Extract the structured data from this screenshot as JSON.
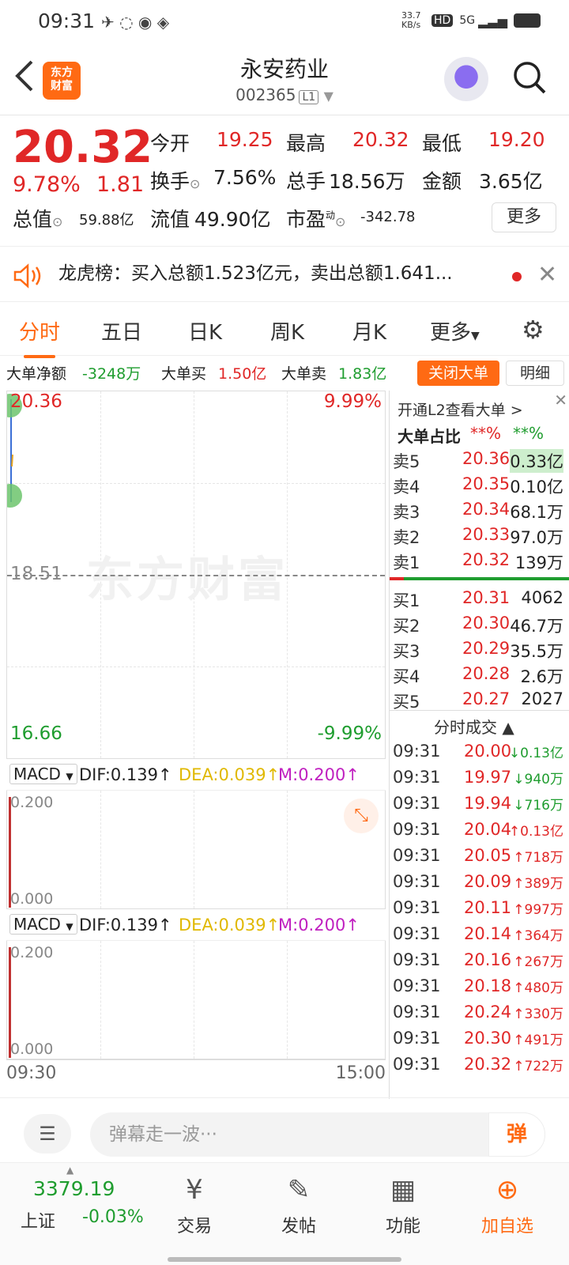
{
  "status": {
    "time": "09:31",
    "speed": "33.7 KB/s",
    "hd": "HD",
    "net": "5G"
  },
  "header": {
    "back": "<",
    "logo_line1": "东方",
    "logo_line2": "财富",
    "title": "永安药业",
    "code": "002365",
    "code_tag": "L1"
  },
  "quote": {
    "price": "20.32",
    "change_pct": "9.78%",
    "change": "1.81",
    "open_label": "今开",
    "open": "19.25",
    "high_label": "最高",
    "high": "20.32",
    "low_label": "最低",
    "low": "19.20",
    "turnover_label": "换手",
    "turnover": "7.56%",
    "volume_label": "总手",
    "volume": "18.56万",
    "amount_label": "金额",
    "amount": "3.65亿",
    "mktcap_label": "总值",
    "mktcap": "59.88亿",
    "float_label": "流值",
    "float": "49.90亿",
    "pe_label": "市盈",
    "pe_sup": "动",
    "pe": "-342.78",
    "more": "更多"
  },
  "notice": {
    "text": "龙虎榜：买入总额1.523亿元，卖出总额1.641..."
  },
  "tabs": [
    "分时",
    "五日",
    "日K",
    "周K",
    "月K",
    "更多"
  ],
  "bigorder": {
    "net_label": "大单净额",
    "net": "-3248万",
    "buy_label": "大单买",
    "buy": "1.50亿",
    "sell_label": "大单卖",
    "sell": "1.83亿",
    "close": "关闭大单",
    "detail": "明细"
  },
  "chart": {
    "top_price": "20.36",
    "top_pct": "9.99%",
    "mid_price": "18.51",
    "bottom_price": "16.66",
    "bottom_pct": "-9.99%",
    "watermark": "东方财富",
    "x_start": "09:30",
    "x_end": "15:00"
  },
  "macd1": {
    "name": "MACD",
    "dif": "DIF:0.139",
    "dea": "DEA:0.039",
    "m": "M:0.200",
    "y_top": "0.200",
    "y_bottom": "0.000"
  },
  "macd2": {
    "name": "MACD",
    "dif": "DIF:0.139",
    "dea": "DEA:0.039",
    "m": "M:0.200",
    "y_top": "0.200",
    "y_bottom": "0.000"
  },
  "book": {
    "l2": "开通L2查看大单 >",
    "ratio_label": "大单占比",
    "ratio_a": "**%",
    "ratio_b": "**%",
    "sells": [
      {
        "l": "卖5",
        "p": "20.36",
        "v": "0.33亿"
      },
      {
        "l": "卖4",
        "p": "20.35",
        "v": "0.10亿"
      },
      {
        "l": "卖3",
        "p": "20.34",
        "v": "68.1万"
      },
      {
        "l": "卖2",
        "p": "20.33",
        "v": "97.0万"
      },
      {
        "l": "卖1",
        "p": "20.32",
        "v": "139万"
      }
    ],
    "buys": [
      {
        "l": "买1",
        "p": "20.31",
        "v": "4062"
      },
      {
        "l": "买2",
        "p": "20.30",
        "v": "46.7万"
      },
      {
        "l": "买3",
        "p": "20.29",
        "v": "35.5万"
      },
      {
        "l": "买4",
        "p": "20.28",
        "v": "2.6万"
      },
      {
        "l": "买5",
        "p": "20.27",
        "v": "2027"
      }
    ],
    "trades_title": "分时成交 ▲",
    "trades": [
      {
        "t": "09:31",
        "p": "20.00",
        "v": "↓0.13亿",
        "dir": "down"
      },
      {
        "t": "09:31",
        "p": "19.97",
        "v": "↓940万",
        "dir": "down"
      },
      {
        "t": "09:31",
        "p": "19.94",
        "v": "↓716万",
        "dir": "down"
      },
      {
        "t": "09:31",
        "p": "20.04",
        "v": "↑0.13亿",
        "dir": "up"
      },
      {
        "t": "09:31",
        "p": "20.05",
        "v": "↑718万",
        "dir": "up"
      },
      {
        "t": "09:31",
        "p": "20.09",
        "v": "↑389万",
        "dir": "up"
      },
      {
        "t": "09:31",
        "p": "20.11",
        "v": "↑997万",
        "dir": "up"
      },
      {
        "t": "09:31",
        "p": "20.14",
        "v": "↑364万",
        "dir": "up"
      },
      {
        "t": "09:31",
        "p": "20.16",
        "v": "↑267万",
        "dir": "up"
      },
      {
        "t": "09:31",
        "p": "20.18",
        "v": "↑480万",
        "dir": "up"
      },
      {
        "t": "09:31",
        "p": "20.24",
        "v": "↑330万",
        "dir": "up"
      },
      {
        "t": "09:31",
        "p": "20.30",
        "v": "↑491万",
        "dir": "up"
      },
      {
        "t": "09:31",
        "p": "20.32",
        "v": "↑722万",
        "dir": "up"
      }
    ]
  },
  "danmu": {
    "placeholder": "弹幕走一波···",
    "send": "弹"
  },
  "nav": {
    "index_val": "3379.19",
    "index_name": "上证",
    "index_chg": "-0.03%",
    "items": [
      "交易",
      "发帖",
      "功能",
      "加自选"
    ]
  }
}
